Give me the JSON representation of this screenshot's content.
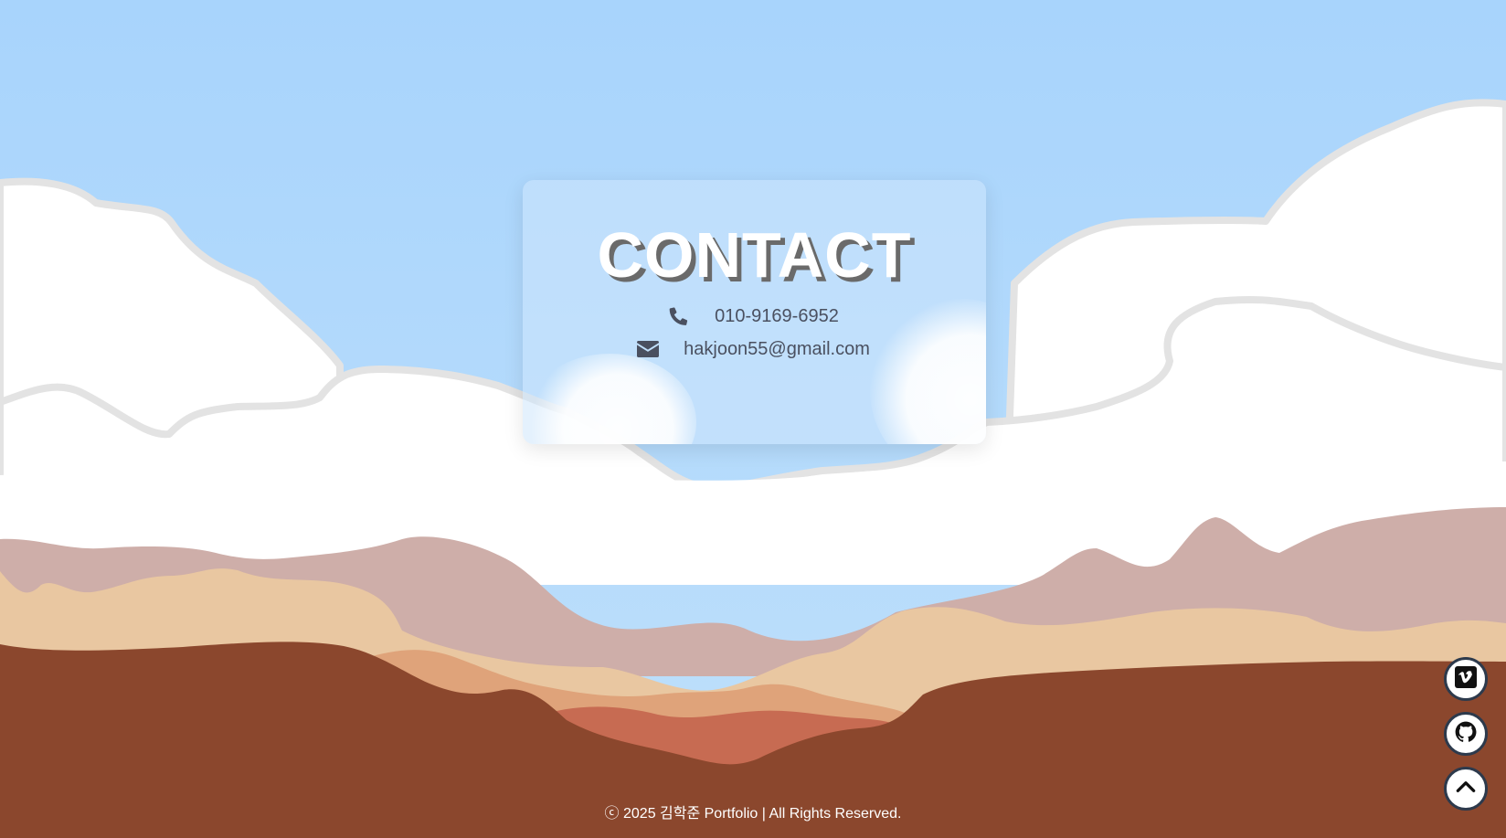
{
  "contact": {
    "title": "CONTACT",
    "phone": "010-9169-6952",
    "email": "hakjoon55@gmail.com",
    "phone_icon": "phone-icon",
    "email_icon": "envelope-icon"
  },
  "footer": {
    "copyright": "ⓒ 2025 김학준 Portfolio | All Rights Reserved."
  },
  "floating_buttons": [
    {
      "icon": "vimeo-icon"
    },
    {
      "icon": "github-icon"
    },
    {
      "icon": "chevron-up-icon"
    }
  ],
  "colors": {
    "sky": "#aad4fb",
    "cloud": "#ffffff",
    "cloud_outline": "#e2e2e2",
    "hill_mauve": "#ceaea9",
    "hill_sand": "#e9c7a1",
    "hill_orange": "#dfa37a",
    "hill_red": "#c76b52",
    "ground": "#8b472d",
    "text_dark": "#4a5060"
  }
}
